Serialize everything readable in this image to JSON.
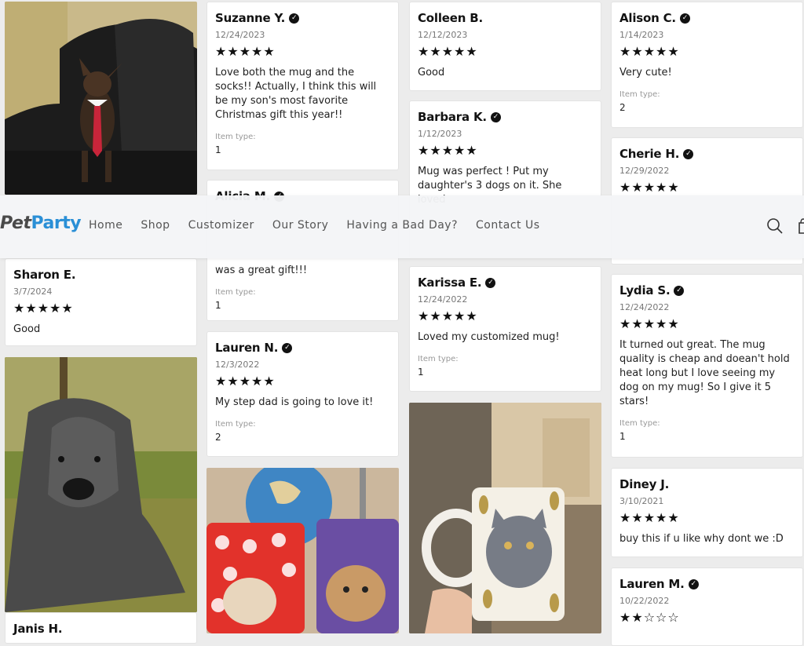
{
  "header": {
    "logo_part1": "Pet",
    "logo_part2": "Party",
    "nav": [
      "Home",
      "Shop",
      "Customizer",
      "Our Story",
      "Having a Bad Day?",
      "Contact Us"
    ]
  },
  "reviews": {
    "c1_sharon": {
      "name": "Sharon E.",
      "date": "3/7/2024",
      "stars": "★★★★★",
      "body": "Good"
    },
    "c1_janis": {
      "name": "Janis H."
    },
    "c2_suzanne": {
      "name": "Suzanne Y.",
      "date": "12/24/2023",
      "stars": "★★★★★",
      "body": "Love both the mug and the socks!! Actually, I think this will be my son's most favorite Christmas gift this year!!",
      "itype_label": "Item type:",
      "itype_val": "1"
    },
    "c2_alicia": {
      "name": "Alicia M.",
      "body": "was a great gift!!!",
      "itype_label": "Item type:",
      "itype_val": "1"
    },
    "c2_lauren": {
      "name": "Lauren N.",
      "date": "12/3/2022",
      "stars": "★★★★★",
      "body": "My step dad is going to love it!",
      "itype_label": "Item type:",
      "itype_val": "2"
    },
    "c3_colleen": {
      "name": "Colleen B.",
      "date": "12/12/2023",
      "stars": "★★★★★",
      "body": "Good"
    },
    "c3_barbara": {
      "name": "Barbara K.",
      "date": "1/12/2023",
      "stars": "★★★★★",
      "body": "Mug was perfect ! Put my daughter's 3 dogs on it. She loved"
    },
    "c3_karissa": {
      "name": "Karissa E.",
      "date": "12/24/2022",
      "stars": "★★★★★",
      "body": "Loved my customized mug!",
      "itype_label": "Item type:",
      "itype_val": "1"
    },
    "c4_alison": {
      "name": "Alison C.",
      "date": "1/14/2023",
      "stars": "★★★★★",
      "body": "Very cute!",
      "itype_label": "Item type:",
      "itype_val": "2"
    },
    "c4_cherie": {
      "name": "Cherie H.",
      "date": "12/29/2022",
      "stars": "★★★★★"
    },
    "c4_lydia": {
      "name": "Lydia S.",
      "date": "12/24/2022",
      "stars": "★★★★★",
      "body": "It turned out great. The mug quality is cheap and doean't hold heat long but I love seeing my dog on my mug!  So I give it 5 stars!",
      "itype_label": "Item type:",
      "itype_val": "1"
    },
    "c4_diney": {
      "name": "Diney J.",
      "date": "3/10/2021",
      "stars": "★★★★★",
      "body": "buy this if u like why dont we :D"
    },
    "c4_lauren": {
      "name": "Lauren M.",
      "date": "10/22/2022",
      "stars": "★★☆☆☆"
    }
  },
  "icon_names": {
    "verified": "check-circle-icon",
    "search": "search-icon",
    "cart": "cart-icon"
  }
}
